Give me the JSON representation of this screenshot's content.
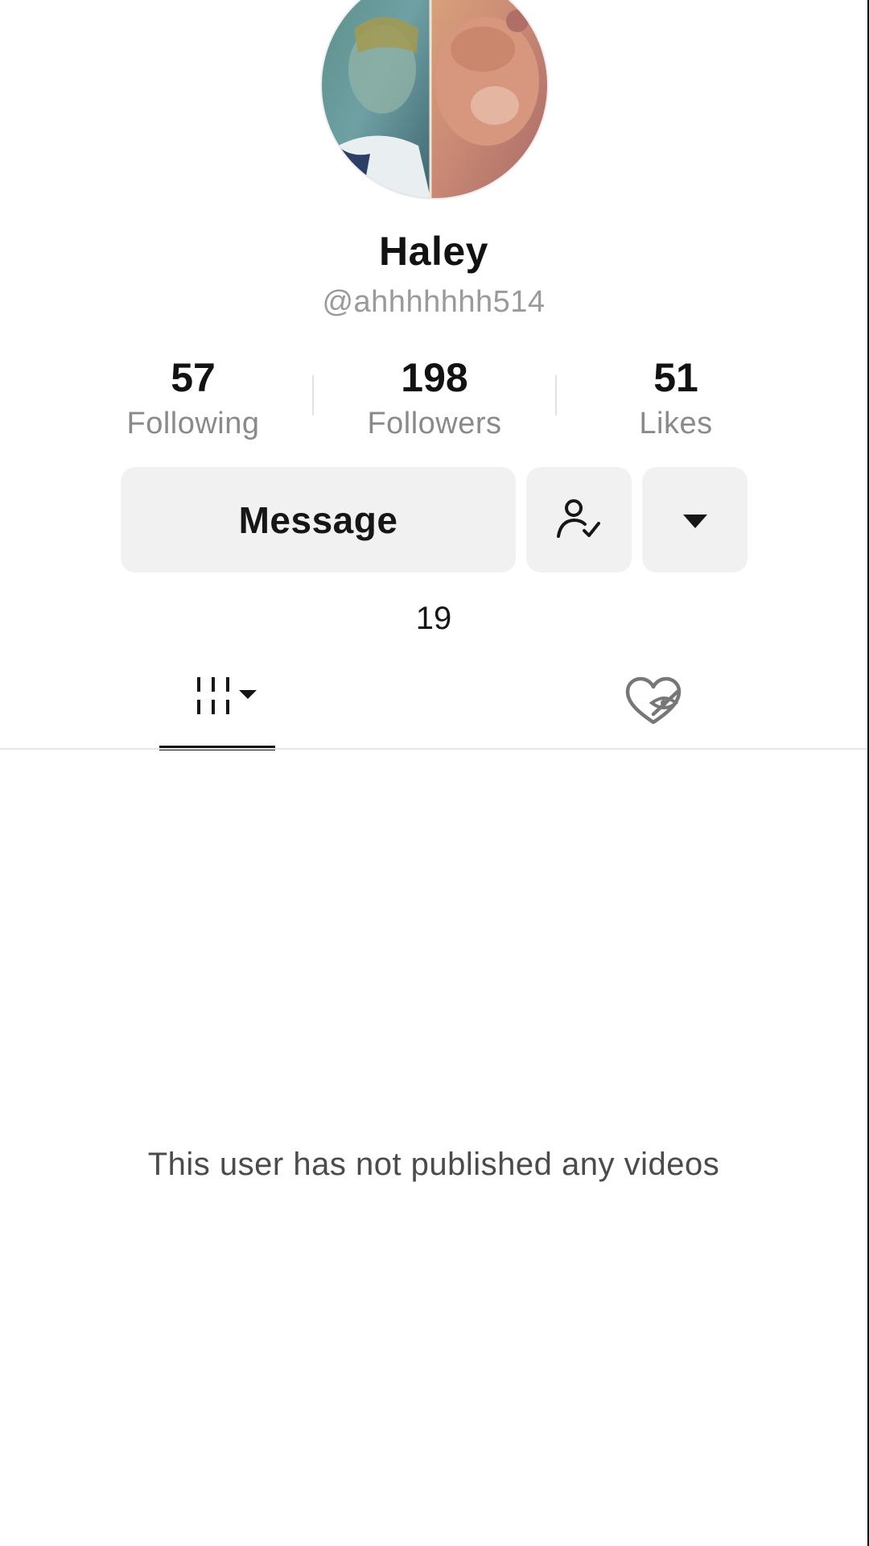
{
  "profile": {
    "display_name": "Haley",
    "username": "@ahhhhhhh514",
    "bio": "19"
  },
  "stats": {
    "following": {
      "value": "57",
      "label": "Following"
    },
    "followers": {
      "value": "198",
      "label": "Followers"
    },
    "likes": {
      "value": "51",
      "label": "Likes"
    }
  },
  "actions": {
    "message_label": "Message",
    "friend_icon": "person-check-icon",
    "more_icon": "caret-down-icon"
  },
  "tabs": [
    {
      "icon": "videos-grid-icon",
      "active": true
    },
    {
      "icon": "liked-hidden-icon",
      "active": false
    }
  ],
  "empty_state": {
    "text": "This user has not published any videos"
  },
  "colors": {
    "background": "#ffffff",
    "button_bg": "#f1f1f2",
    "text_primary": "#161616",
    "text_secondary": "#8a8a8a"
  }
}
